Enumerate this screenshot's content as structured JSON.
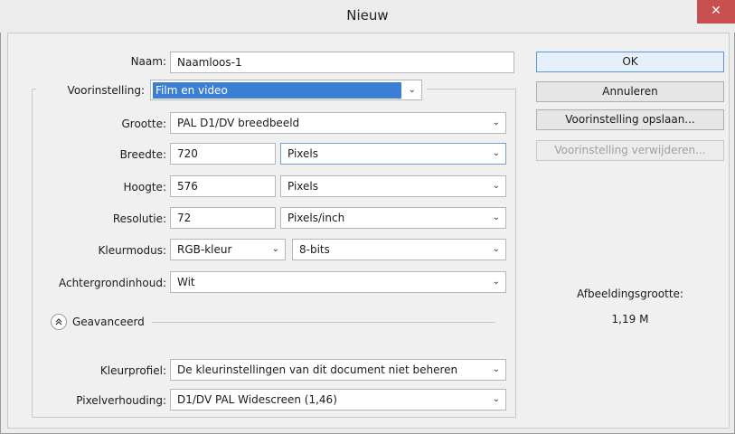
{
  "window": {
    "title": "Nieuw",
    "close_glyph": "✕"
  },
  "form": {
    "name": {
      "label": "Naam:",
      "value": "Naamloos-1"
    },
    "preset": {
      "label": "Voorinstelling:",
      "value": "Film en video"
    },
    "size": {
      "label": "Grootte:",
      "value": "PAL D1/DV breedbeeld"
    },
    "width": {
      "label": "Breedte:",
      "value": "720",
      "unit": "Pixels"
    },
    "height": {
      "label": "Hoogte:",
      "value": "576",
      "unit": "Pixels"
    },
    "resolution": {
      "label": "Resolutie:",
      "value": "72",
      "unit": "Pixels/inch"
    },
    "color_mode": {
      "label": "Kleurmodus:",
      "value": "RGB-kleur",
      "bits": "8-bits"
    },
    "background": {
      "label": "Achtergrondinhoud:",
      "value": "Wit"
    },
    "advanced": {
      "label": "Geavanceerd",
      "icon": "collapse-chevrons-icon"
    },
    "color_profile": {
      "label": "Kleurprofiel:",
      "value": "De kleurinstellingen van dit document niet beheren"
    },
    "pixel_aspect": {
      "label": "Pixelverhouding:",
      "value": "D1/DV PAL Widescreen (1,46)"
    }
  },
  "buttons": {
    "ok": "OK",
    "cancel": "Annuleren",
    "save_preset": "Voorinstelling opslaan...",
    "delete_preset": "Voorinstelling verwijderen..."
  },
  "image_size": {
    "label": "Afbeeldingsgrootte:",
    "value": "1,19 M"
  },
  "chevron_glyph": "⌄",
  "colors": {
    "close": "#c84f4f",
    "selection": "#3b7fd4",
    "ok_border": "#5d97d8"
  }
}
